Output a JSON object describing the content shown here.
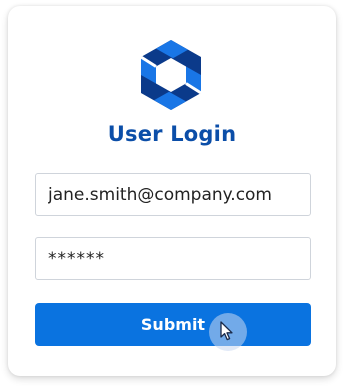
{
  "login": {
    "title": "User Login",
    "email_value": "jane.smith@company.com",
    "password_value": "******",
    "submit_label": "Submit"
  },
  "icons": {
    "logo": "hexagon-logo-icon",
    "cursor": "mouse-pointer-icon"
  },
  "colors": {
    "brand_dark": "#0b3a8a",
    "brand_light": "#1976e6",
    "title": "#0b4ea8",
    "button": "#0a73e0"
  }
}
